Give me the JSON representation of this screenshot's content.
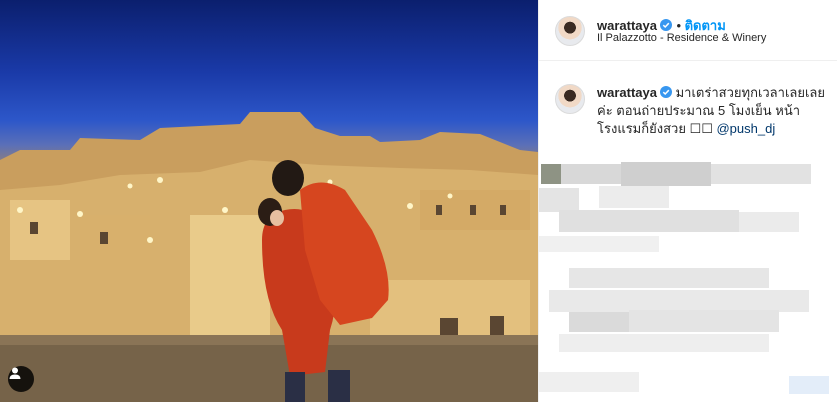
{
  "post": {
    "username": "warattaya",
    "follow_label": "ติดตาม",
    "location": "Il Palazzotto - Residence & Winery",
    "caption_username": "warattaya",
    "caption_text": "มาเตร่าสวยทุกเวลาเลยเลยค่ะ ตอนถ่ายประมาณ 5 โมงเย็น หน้าโรงแรมก็ยังสวย ☐☐",
    "caption_mention": "@push_dj"
  },
  "colors": {
    "link": "#0095f6",
    "verified": "#3897f0",
    "mention": "#00376b"
  },
  "icons": [
    "verified-badge-icon",
    "user-tag-icon"
  ]
}
